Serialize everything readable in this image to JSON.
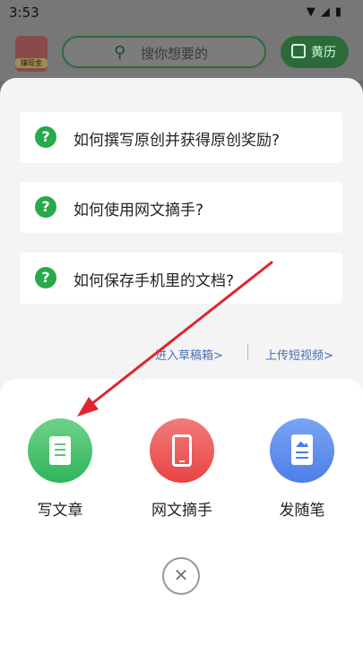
{
  "status": {
    "time": "3:53",
    "icons": "▼◢▮"
  },
  "topbar": {
    "gift_label": "赚现金",
    "search_placeholder": "搜你想要的",
    "calendar_label": "黄历"
  },
  "faqs": [
    {
      "text": "如何撰写原创并获得原创奖励?"
    },
    {
      "text": "如何使用网文摘手?"
    },
    {
      "text": "如何保存手机里的文档?"
    }
  ],
  "links": {
    "draft": "进入草稿箱>",
    "upload": "上传短视频>"
  },
  "actions": {
    "write": "写文章",
    "clip": "网文摘手",
    "note": "发随笔"
  },
  "colors": {
    "green": "#27a94c",
    "red": "#e84444",
    "blue": "#4d7ee8",
    "arrow": "#e0252c"
  }
}
